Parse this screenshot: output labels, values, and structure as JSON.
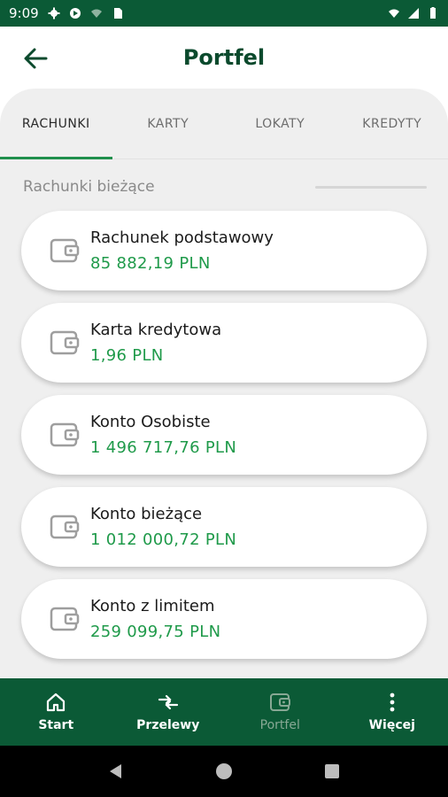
{
  "status_bar": {
    "time": "9:09"
  },
  "app_bar": {
    "title": "Portfel"
  },
  "tabs": [
    {
      "label": "RACHUNKI",
      "active": true
    },
    {
      "label": "KARTY",
      "active": false
    },
    {
      "label": "LOKATY",
      "active": false
    },
    {
      "label": "KREDYTY",
      "active": false
    }
  ],
  "section": {
    "title": "Rachunki bieżące"
  },
  "accounts": [
    {
      "name": "Rachunek podstawowy",
      "balance": "85 882,19 PLN",
      "icon": "wallet-icon"
    },
    {
      "name": "Karta kredytowa",
      "balance": "1,96 PLN",
      "icon": "wallet-icon"
    },
    {
      "name": "Konto Osobiste",
      "balance": "1 496 717,76 PLN",
      "icon": "wallet-icon"
    },
    {
      "name": "Konto bieżące",
      "balance": "1 012 000,72 PLN",
      "icon": "wallet-icon"
    },
    {
      "name": "Konto z limitem",
      "balance": "259 099,75 PLN",
      "icon": "wallet-icon"
    }
  ],
  "bottom_nav": [
    {
      "label": "Start",
      "icon": "home-icon",
      "active": false
    },
    {
      "label": "Przelewy",
      "icon": "transfer-icon",
      "active": false
    },
    {
      "label": "Portfel",
      "icon": "wallet-icon",
      "active": true
    },
    {
      "label": "Więcej",
      "icon": "more-vertical-icon",
      "active": false
    }
  ],
  "colors": {
    "primary": "#0b5a36",
    "accent": "#1f9a4a",
    "title": "#0b4a2d",
    "background": "#efefef"
  }
}
